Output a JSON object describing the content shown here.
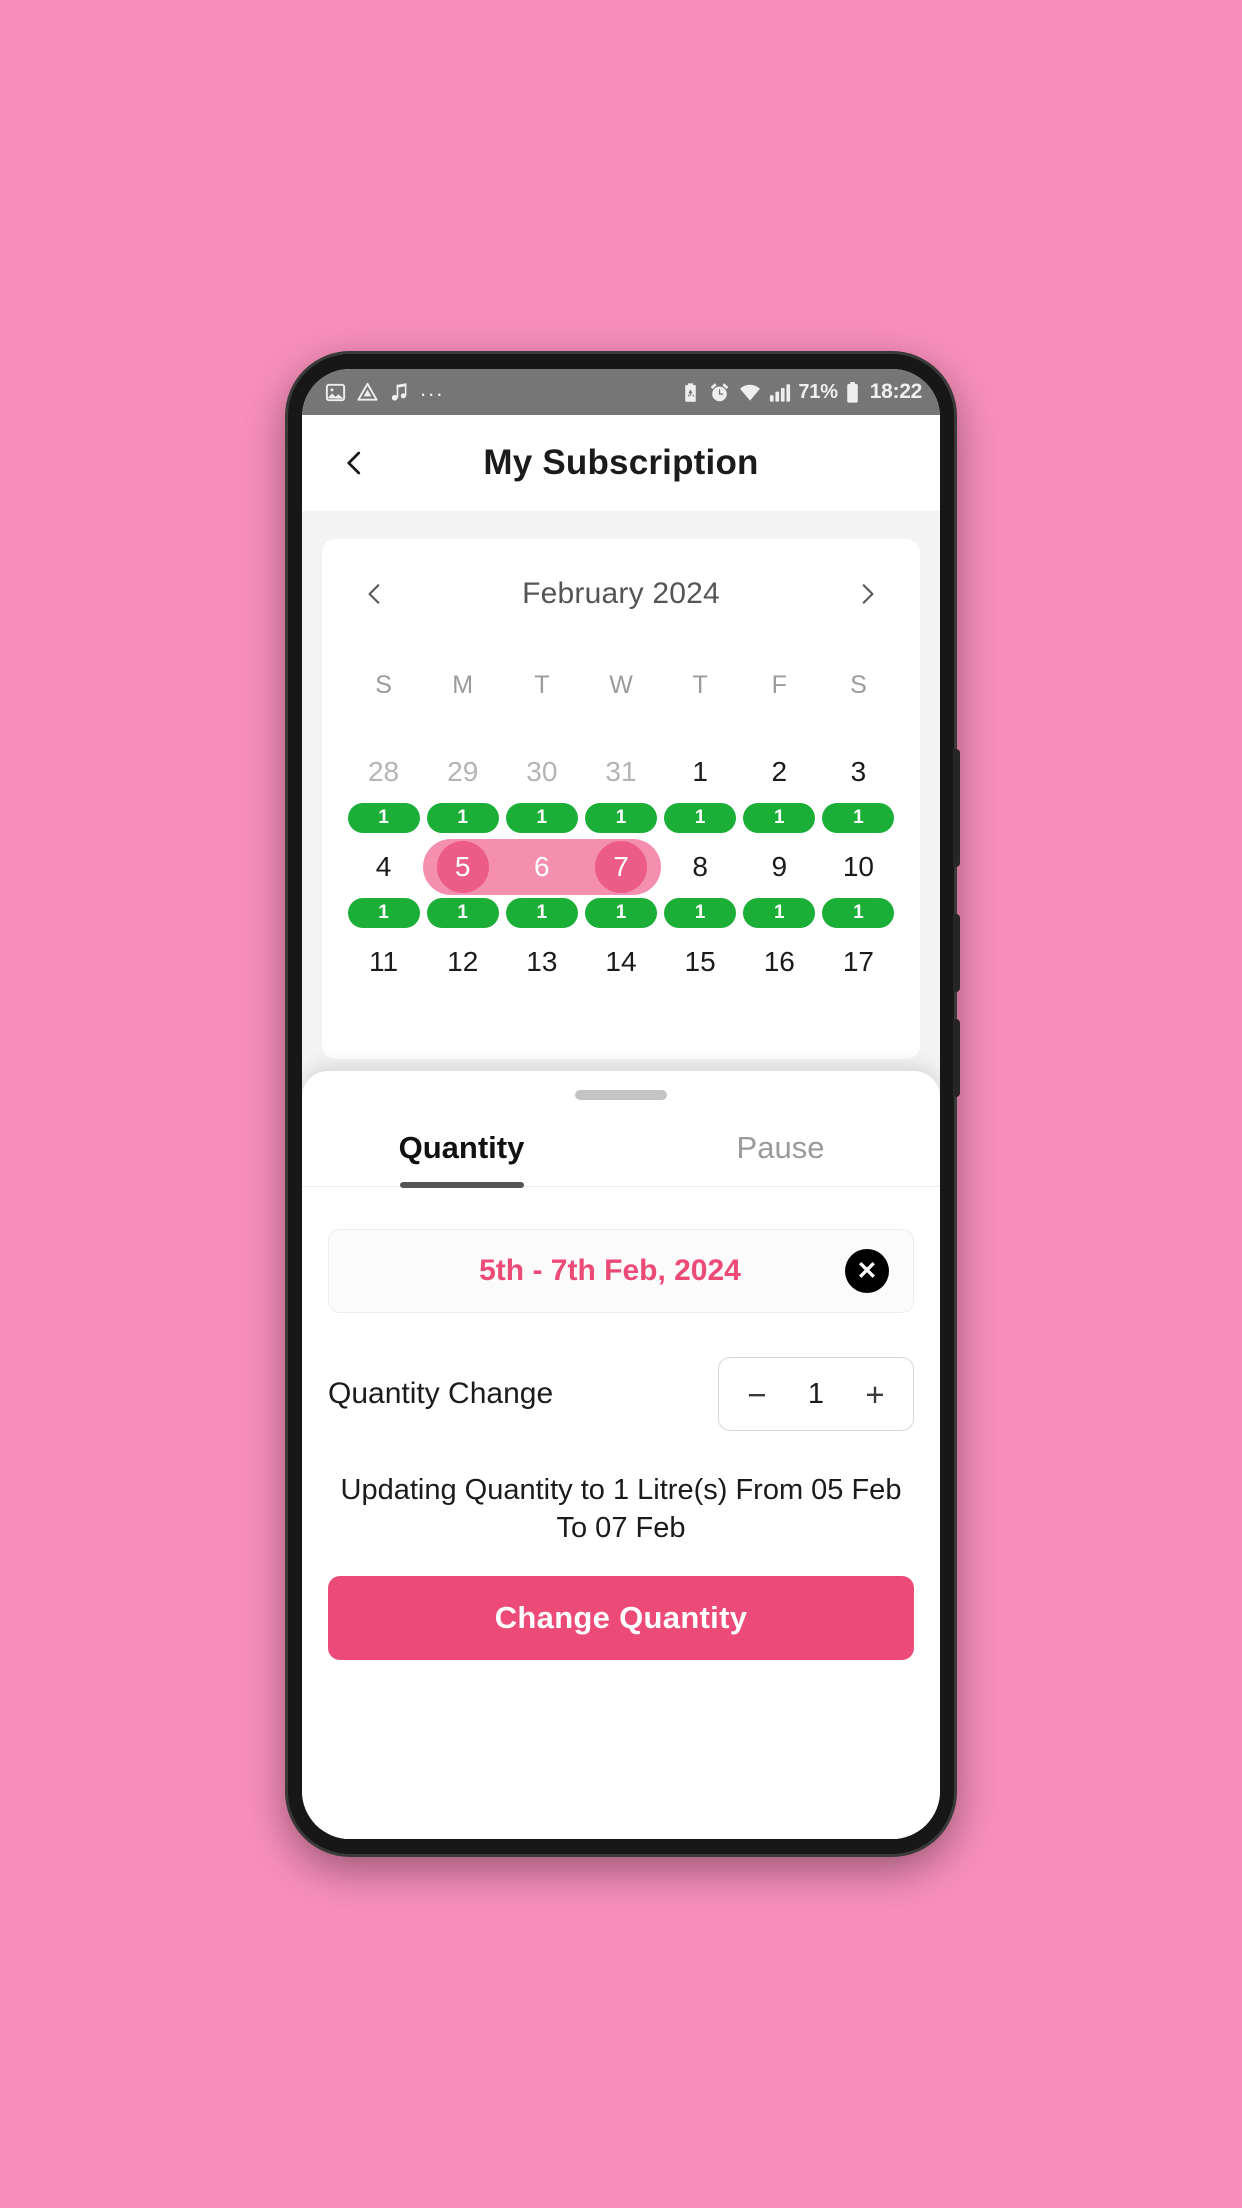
{
  "statusbar": {
    "left_icons": [
      "image-icon",
      "drive-triangle-icon",
      "music-note-icon"
    ],
    "overflow": "...",
    "right_icons": [
      "battery-saver-icon",
      "alarm-clock-icon",
      "wifi-icon",
      "signal-bars-icon"
    ],
    "battery_percent": "71%",
    "time": "18:22"
  },
  "appbar": {
    "back_icon": "chevron-left-icon",
    "title": "My Subscription"
  },
  "calendar": {
    "prev_icon": "chevron-left-icon",
    "next_icon": "chevron-right-icon",
    "month_label": "February 2024",
    "dow": [
      "S",
      "M",
      "T",
      "W",
      "T",
      "F",
      "S"
    ],
    "weeks": [
      {
        "days": [
          {
            "num": "28",
            "muted": true,
            "badge": "1",
            "sel": "none"
          },
          {
            "num": "29",
            "muted": true,
            "badge": "1",
            "sel": "none"
          },
          {
            "num": "30",
            "muted": true,
            "badge": "1",
            "sel": "none"
          },
          {
            "num": "31",
            "muted": true,
            "badge": "1",
            "sel": "none"
          },
          {
            "num": "1",
            "muted": false,
            "badge": "1",
            "sel": "none"
          },
          {
            "num": "2",
            "muted": false,
            "badge": "1",
            "sel": "none"
          },
          {
            "num": "3",
            "muted": false,
            "badge": "1",
            "sel": "none"
          }
        ]
      },
      {
        "days": [
          {
            "num": "4",
            "muted": false,
            "badge": "1",
            "sel": "none"
          },
          {
            "num": "5",
            "muted": false,
            "badge": "1",
            "sel": "start"
          },
          {
            "num": "6",
            "muted": false,
            "badge": "1",
            "sel": "mid"
          },
          {
            "num": "7",
            "muted": false,
            "badge": "1",
            "sel": "end"
          },
          {
            "num": "8",
            "muted": false,
            "badge": "1",
            "sel": "none"
          },
          {
            "num": "9",
            "muted": false,
            "badge": "1",
            "sel": "none"
          },
          {
            "num": "10",
            "muted": false,
            "badge": "1",
            "sel": "none"
          }
        ]
      },
      {
        "days": [
          {
            "num": "11",
            "muted": false,
            "badge": "",
            "sel": "none"
          },
          {
            "num": "12",
            "muted": false,
            "badge": "",
            "sel": "none"
          },
          {
            "num": "13",
            "muted": false,
            "badge": "",
            "sel": "none"
          },
          {
            "num": "14",
            "muted": false,
            "badge": "",
            "sel": "none"
          },
          {
            "num": "15",
            "muted": false,
            "badge": "",
            "sel": "none"
          },
          {
            "num": "16",
            "muted": false,
            "badge": "",
            "sel": "none"
          },
          {
            "num": "17",
            "muted": false,
            "badge": "",
            "sel": "none"
          }
        ]
      }
    ]
  },
  "sheet": {
    "tabs": [
      {
        "label": "Quantity",
        "active": true
      },
      {
        "label": "Pause",
        "active": false
      }
    ],
    "selected_range": "5th - 7th Feb, 2024",
    "clear_icon": "close-circle-icon",
    "quantity_label": "Quantity Change",
    "stepper": {
      "minus": "−",
      "value": "1",
      "plus": "+"
    },
    "info": "Updating Quantity to 1 Litre(s) From 05 Feb To 07 Feb",
    "cta_label": "Change Quantity"
  },
  "colors": {
    "page_bg": "#F78FB9",
    "accent_pink": "#EC4B78",
    "range_band": "#F48FAF",
    "badge_green": "#1BAF37",
    "statusbar_gray": "#767676"
  }
}
